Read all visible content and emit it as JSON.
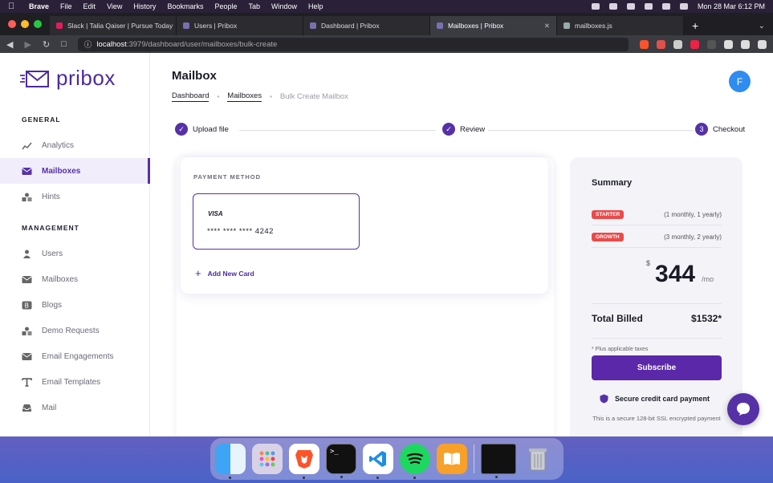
{
  "menubar": {
    "app": "Brave",
    "items": [
      "File",
      "Edit",
      "View",
      "History",
      "Bookmarks",
      "People",
      "Tab",
      "Window",
      "Help"
    ],
    "clock": "Mon 28 Mar  6:12 PM"
  },
  "browser": {
    "tabs": [
      {
        "title": "Slack | Talia Qaiser | Pursue Today",
        "active": false
      },
      {
        "title": "Users | Pribox",
        "active": false
      },
      {
        "title": "Dashboard | Pribox",
        "active": false
      },
      {
        "title": "Mailboxes | Pribox",
        "active": true
      },
      {
        "title": "mailboxes.js",
        "active": false
      }
    ],
    "new_tab": "+",
    "url_host": "localhost",
    "url_path": ":3979/dashboard/user/mailboxes/bulk-create"
  },
  "sidebar": {
    "logo": "pribox",
    "general_title": "GENERAL",
    "general_items": [
      {
        "label": "Analytics",
        "icon": "chart-icon",
        "active": false
      },
      {
        "label": "Mailboxes",
        "icon": "mail-icon",
        "active": true
      },
      {
        "label": "Hints",
        "icon": "shapes-icon",
        "active": false
      }
    ],
    "management_title": "MANAGEMENT",
    "management_items": [
      {
        "label": "Users",
        "icon": "user-icon"
      },
      {
        "label": "Mailboxes",
        "icon": "mail-icon"
      },
      {
        "label": "Blogs",
        "icon": "blog-icon"
      },
      {
        "label": "Demo Requests",
        "icon": "shapes-icon"
      },
      {
        "label": "Email Engagements",
        "icon": "mail-icon"
      },
      {
        "label": "Email Templates",
        "icon": "text-icon"
      },
      {
        "label": "Mail",
        "icon": "inbox-icon"
      }
    ]
  },
  "header": {
    "title": "Mailbox",
    "breadcrumbs": [
      "Dashboard",
      "Mailboxes",
      "Bulk Create Mailbox"
    ],
    "avatar_letter": "F"
  },
  "steps": [
    {
      "label": "Upload file",
      "state": "done"
    },
    {
      "label": "Review",
      "state": "done"
    },
    {
      "label": "Checkout",
      "number": "3",
      "state": "current"
    }
  ],
  "payment": {
    "title": "PAYMENT METHOD",
    "card_brand": "VISA",
    "card_number": "**** **** **** 4242",
    "add_card": "Add New Card"
  },
  "summary": {
    "title": "Summary",
    "plans": [
      {
        "badge": "STARTER",
        "desc": "(1 monthly, 1 yearly)"
      },
      {
        "badge": "GROWTH",
        "desc": "(3 monthly, 2 yearly)"
      }
    ],
    "currency": "$",
    "amount": "344",
    "period": "/mo",
    "total_label": "Total Billed",
    "total_value": "$1532*",
    "taxes_note": "* Plus applicable taxes",
    "subscribe": "Subscribe",
    "secure_title": "Secure credit card payment",
    "secure_text": "This is a secure 128-bit SSL encrypted payment"
  },
  "colors": {
    "brand": "#5631a6",
    "badge": "#ec4a4a",
    "avatar": "#2f8cf0"
  }
}
